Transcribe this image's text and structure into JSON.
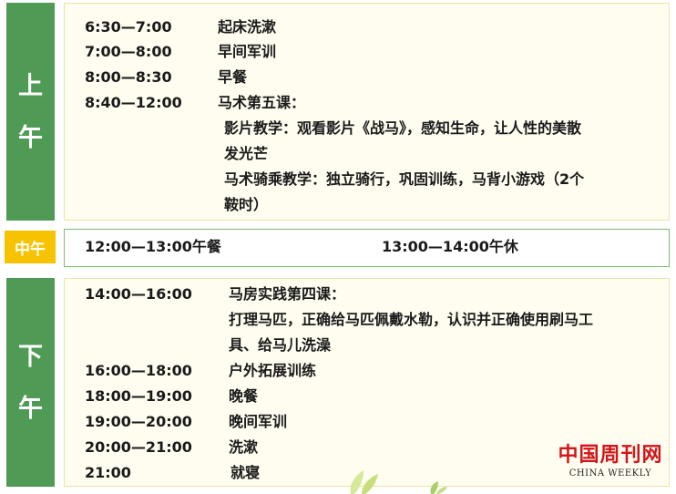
{
  "am": {
    "side_label": [
      "上",
      "午"
    ],
    "rows": [
      {
        "time": "6:30—7:00",
        "activity": "起床洗漱"
      },
      {
        "time": "7:00—8:00",
        "activity": "早间军训"
      },
      {
        "time": "8:00—8:30",
        "activity": "早餐"
      },
      {
        "time": "8:40—12:00",
        "activity": "马术第五课："
      }
    ],
    "details": [
      "影片教学：观看影片《战马》，感知生命，让人性的美散",
      "发光芒",
      "马术骑乘教学：独立骑行，巩固训练，马背小游戏（2个",
      "鞍时）"
    ]
  },
  "noon": {
    "label": "中午",
    "items": [
      "12:00—13:00午餐",
      "13:00—14:00午休"
    ]
  },
  "pm": {
    "side_label": [
      "下",
      "午"
    ],
    "rows": [
      {
        "time": "14:00—16:00",
        "activity": "马房实践第四课："
      },
      {
        "time": "16:00—18:00",
        "activity": "户外拓展训练"
      },
      {
        "time": "18:00—19:00",
        "activity": "晚餐"
      },
      {
        "time": "19:00—20:00",
        "activity": "晚间军训"
      },
      {
        "time": "20:00—21:00",
        "activity": "洗漱"
      },
      {
        "time": "21:00",
        "activity": "就寝"
      }
    ],
    "details": [
      "打理马匹，正确给马匹佩戴水勒，认识并正确使用刷马工",
      "具、给马儿洗澡"
    ]
  },
  "watermark": {
    "cn": "中国周刊网",
    "en": "CHINA WEEKLY"
  },
  "colors": {
    "side_green": "#4f9a55",
    "noon_yellow": "#f7c300",
    "panel_bg": "#fffdf0",
    "logo_red": "#d0161b"
  }
}
